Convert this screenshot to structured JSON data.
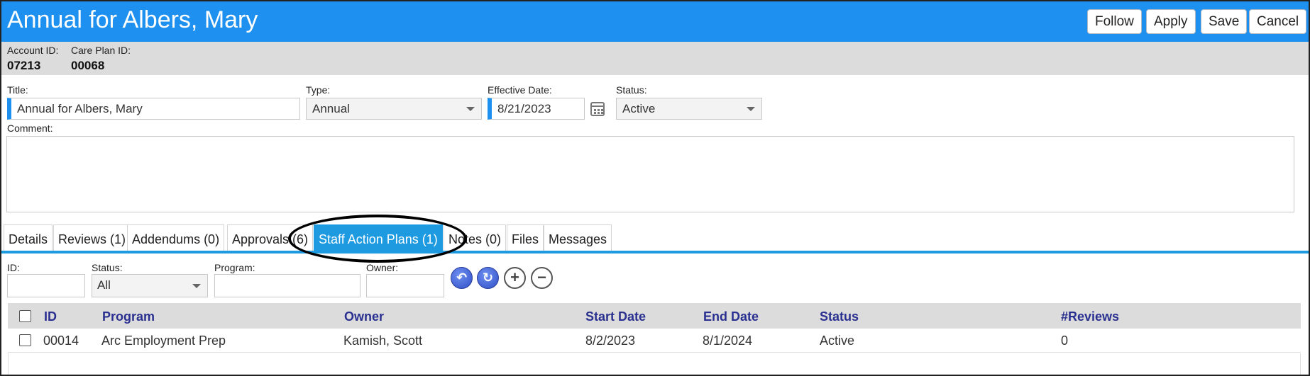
{
  "header": {
    "title": "Annual for Albers, Mary",
    "buttons": {
      "follow": "Follow",
      "apply": "Apply",
      "save": "Save",
      "cancel": "Cancel"
    }
  },
  "info": {
    "account_label": "Account ID:",
    "account_value": "07213",
    "careplan_label": "Care Plan ID:",
    "careplan_value": "00068"
  },
  "form": {
    "title_label": "Title:",
    "title_value": "Annual for Albers, Mary",
    "type_label": "Type:",
    "type_value": "Annual",
    "effective_label": "Effective Date:",
    "effective_value": "8/21/2023",
    "status_label": "Status:",
    "status_value": "Active",
    "comment_label": "Comment:"
  },
  "tabs": [
    {
      "label": "Details"
    },
    {
      "label": "Reviews (1)"
    },
    {
      "label": "Addendums (0)"
    },
    {
      "label": "Approvals (6)"
    },
    {
      "label": "Staff Action Plans (1)"
    },
    {
      "label": "Notes (0)"
    },
    {
      "label": "Files"
    },
    {
      "label": "Messages"
    }
  ],
  "filters": {
    "id_label": "ID:",
    "status_label": "Status:",
    "status_value": "All",
    "program_label": "Program:",
    "owner_label": "Owner:",
    "icons": [
      "undo-icon",
      "refresh-icon",
      "plus-icon",
      "minus-icon"
    ]
  },
  "grid": {
    "columns": [
      "ID",
      "Program",
      "Owner",
      "Start Date",
      "End Date",
      "Status",
      "#Reviews"
    ],
    "rows": [
      {
        "id": "00014",
        "program": "Arc Employment Prep",
        "owner": "Kamish, Scott",
        "start": "8/2/2023",
        "end": "8/1/2024",
        "status": "Active",
        "reviews": "0"
      }
    ]
  },
  "colors": {
    "accent": "#1e90f0",
    "tab_active": "#1e9ae0",
    "header_text": "#2a3090"
  }
}
